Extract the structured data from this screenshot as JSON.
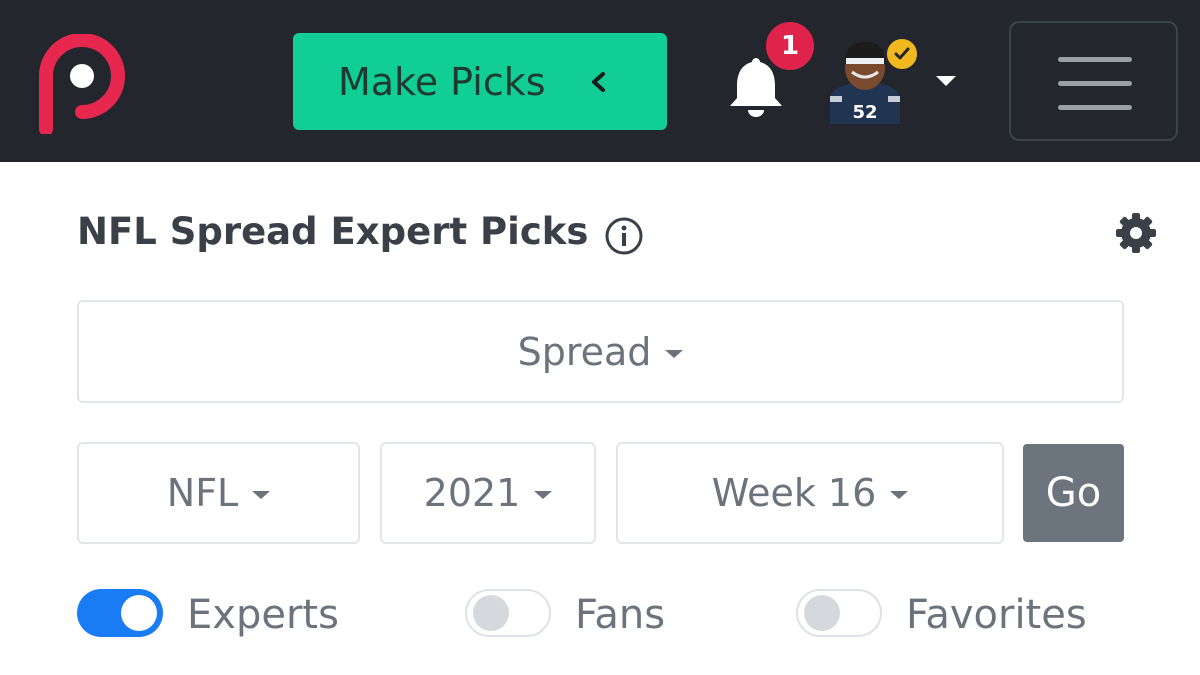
{
  "header": {
    "logo_icon": "pickwatch-logo-icon",
    "make_picks_label": "Make Picks",
    "notifications_count": "1",
    "menu_icon": "hamburger-menu-icon",
    "accent_color": "#10ce94",
    "badge_color": "#e0234a",
    "avatar_jersey_number": "52"
  },
  "main": {
    "title": "NFL Spread Expert Picks",
    "market_select": "Spread",
    "league_select": "NFL",
    "season_select": "2021",
    "week_select": "Week 16",
    "go_label": "Go",
    "toggles": [
      {
        "label": "Experts",
        "on": true
      },
      {
        "label": "Fans",
        "on": false
      },
      {
        "label": "Favorites",
        "on": false
      }
    ]
  }
}
